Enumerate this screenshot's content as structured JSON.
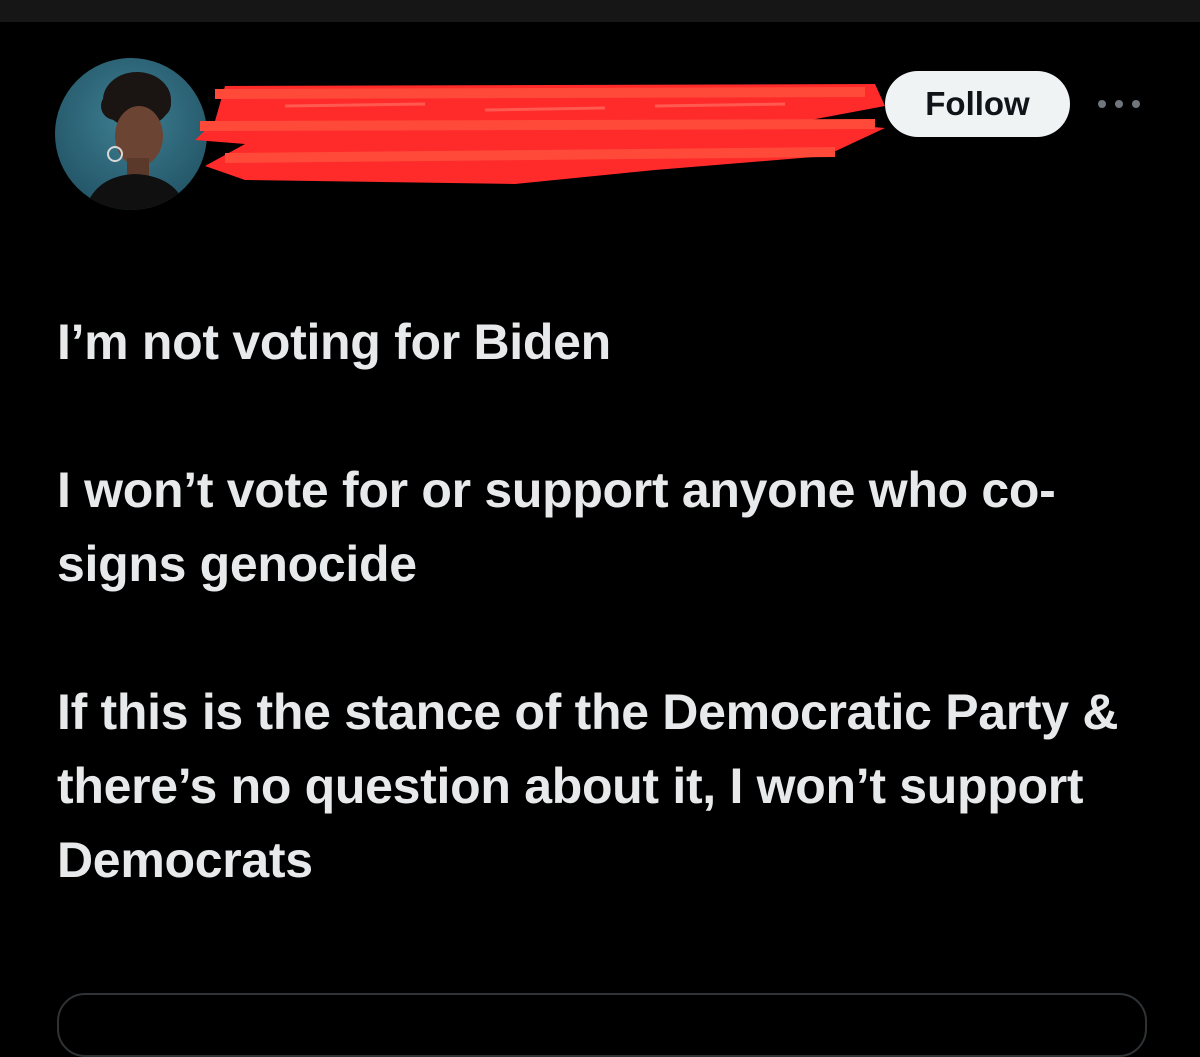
{
  "header": {
    "follow_label": "Follow",
    "more_icon": "more-horizontal-icon",
    "avatar_icon": "profile-photo"
  },
  "tweet": {
    "paragraphs": [
      "I’m not voting for Biden",
      "I won’t vote for or support anyone who co-signs genocide",
      "If this is the stance of the Democratic Party & there’s no question about it, I won’t support Democrats"
    ]
  },
  "colors": {
    "background": "#000000",
    "text": "#e7e9ea",
    "follow_button_bg": "#eff3f4",
    "follow_button_text": "#0f1419",
    "muted_icon": "#71767b",
    "redaction": "#ff2a2a"
  }
}
